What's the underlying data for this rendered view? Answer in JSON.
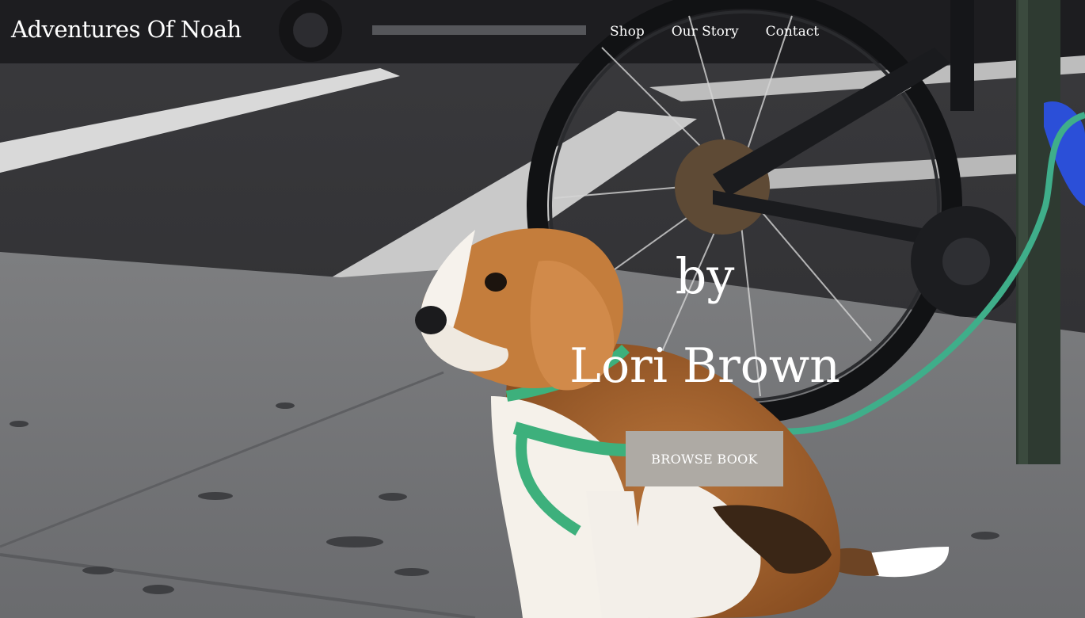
{
  "header": {
    "site_title": "Adventures Of Noah",
    "nav": [
      {
        "label": "Shop"
      },
      {
        "label": "Our Story"
      },
      {
        "label": "Contact"
      }
    ]
  },
  "hero": {
    "byline": "by",
    "author": "Lori Brown",
    "cta_label": "BROWSE BOOK",
    "image_subject": "beagle-on-leash-sidewalk"
  },
  "colors": {
    "button_bg": "#aeaaa4",
    "text": "#ffffff",
    "leash": "#3fae8a"
  }
}
